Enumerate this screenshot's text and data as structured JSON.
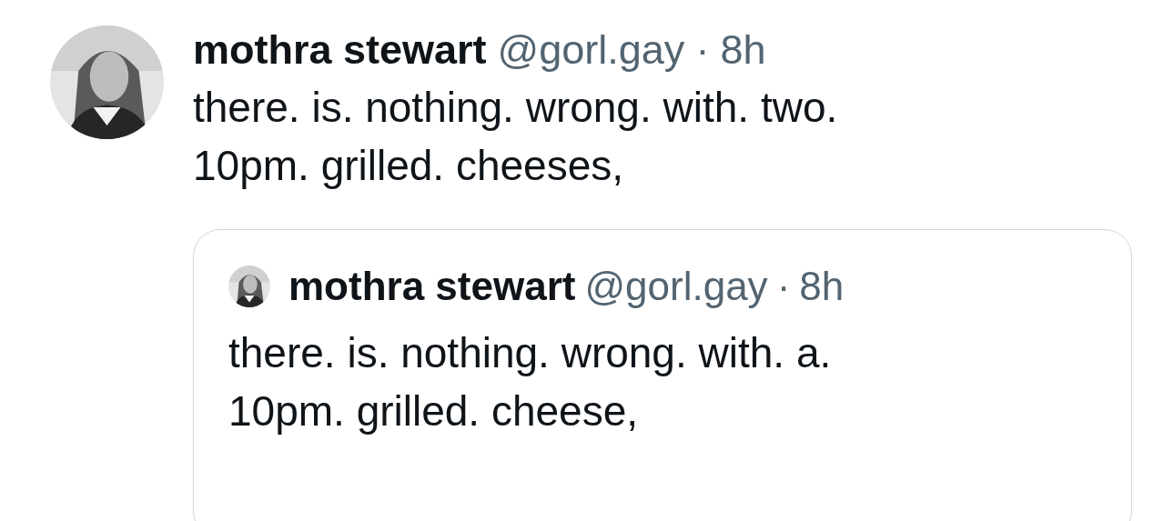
{
  "post": {
    "author_name": "mothra stewart",
    "handle": "@gorl.gay",
    "separator": "·",
    "time": "8h",
    "text": "there. is. nothing. wrong. with. two.\n10pm. grilled. cheeses,"
  },
  "quoted_post": {
    "author_name": "mothra stewart",
    "handle": "@gorl.gay",
    "separator": "·",
    "time": "8h",
    "text": "there. is. nothing. wrong. with. a.\n10pm. grilled. cheese,"
  }
}
